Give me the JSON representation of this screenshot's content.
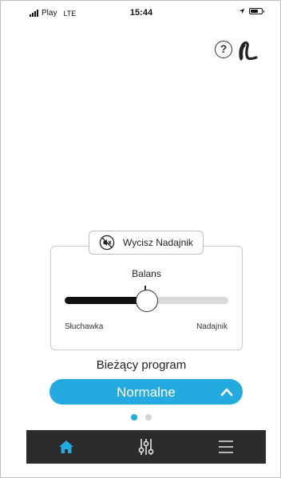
{
  "status_bar": {
    "carrier": "Play",
    "network": "LTE",
    "time": "15:44",
    "battery_level_percent": 70
  },
  "header": {
    "help_glyph": "?",
    "help_icon": "help-circle-icon",
    "device_icon": "hearing-aid-icon"
  },
  "mute": {
    "label": "Wycisz Nadajnik",
    "icon": "muted-speaker-icon"
  },
  "balance": {
    "title": "Balans",
    "left_label": "Słuchawka",
    "right_label": "Nadajnik",
    "value_fraction": 0.5
  },
  "program": {
    "title": "Bieżący program",
    "selected": "Normalne",
    "icon": "chevron-up-icon"
  },
  "pager": {
    "page_count": 2,
    "active_page": 1
  },
  "tabs": [
    {
      "name": "home",
      "icon": "home-icon",
      "active": true
    },
    {
      "name": "equalizer",
      "icon": "sliders-icon",
      "active": false
    },
    {
      "name": "menu",
      "icon": "hamburger-menu-icon",
      "active": false
    }
  ],
  "colors": {
    "accent": "#23aadf",
    "tab_bar": "#2b2b2b",
    "slider_fill": "#111111",
    "slider_track": "#d9d9d9"
  }
}
